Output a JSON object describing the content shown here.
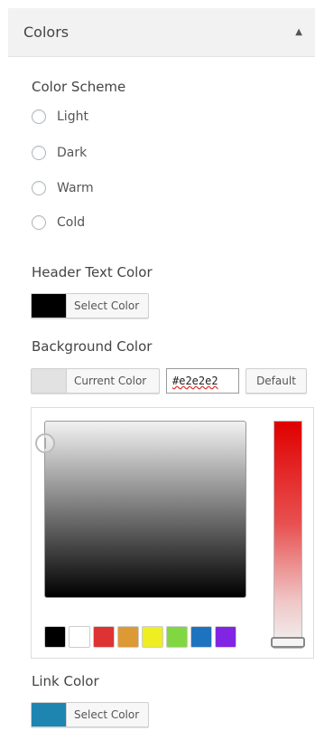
{
  "section": {
    "title": "Colors",
    "collapse_icon": "▲"
  },
  "color_scheme": {
    "title": "Color Scheme",
    "options": [
      {
        "label": "Light"
      },
      {
        "label": "Dark"
      },
      {
        "label": "Warm"
      },
      {
        "label": "Cold"
      }
    ]
  },
  "header_text_color": {
    "title": "Header Text Color",
    "button_label": "Select Color",
    "swatch_color": "#000000"
  },
  "background_color": {
    "title": "Background Color",
    "current_label": "Current Color",
    "hex_value": "#e2e2e2",
    "default_label": "Default",
    "swatch_color": "#e2e2e2",
    "palette": [
      "#000000",
      "#ffffff",
      "#dd3333",
      "#dd9933",
      "#eeee22",
      "#81d742",
      "#1e73be",
      "#8224e3"
    ]
  },
  "link_color": {
    "title": "Link Color",
    "button_label": "Select Color",
    "swatch_color": "#1e85b0"
  }
}
